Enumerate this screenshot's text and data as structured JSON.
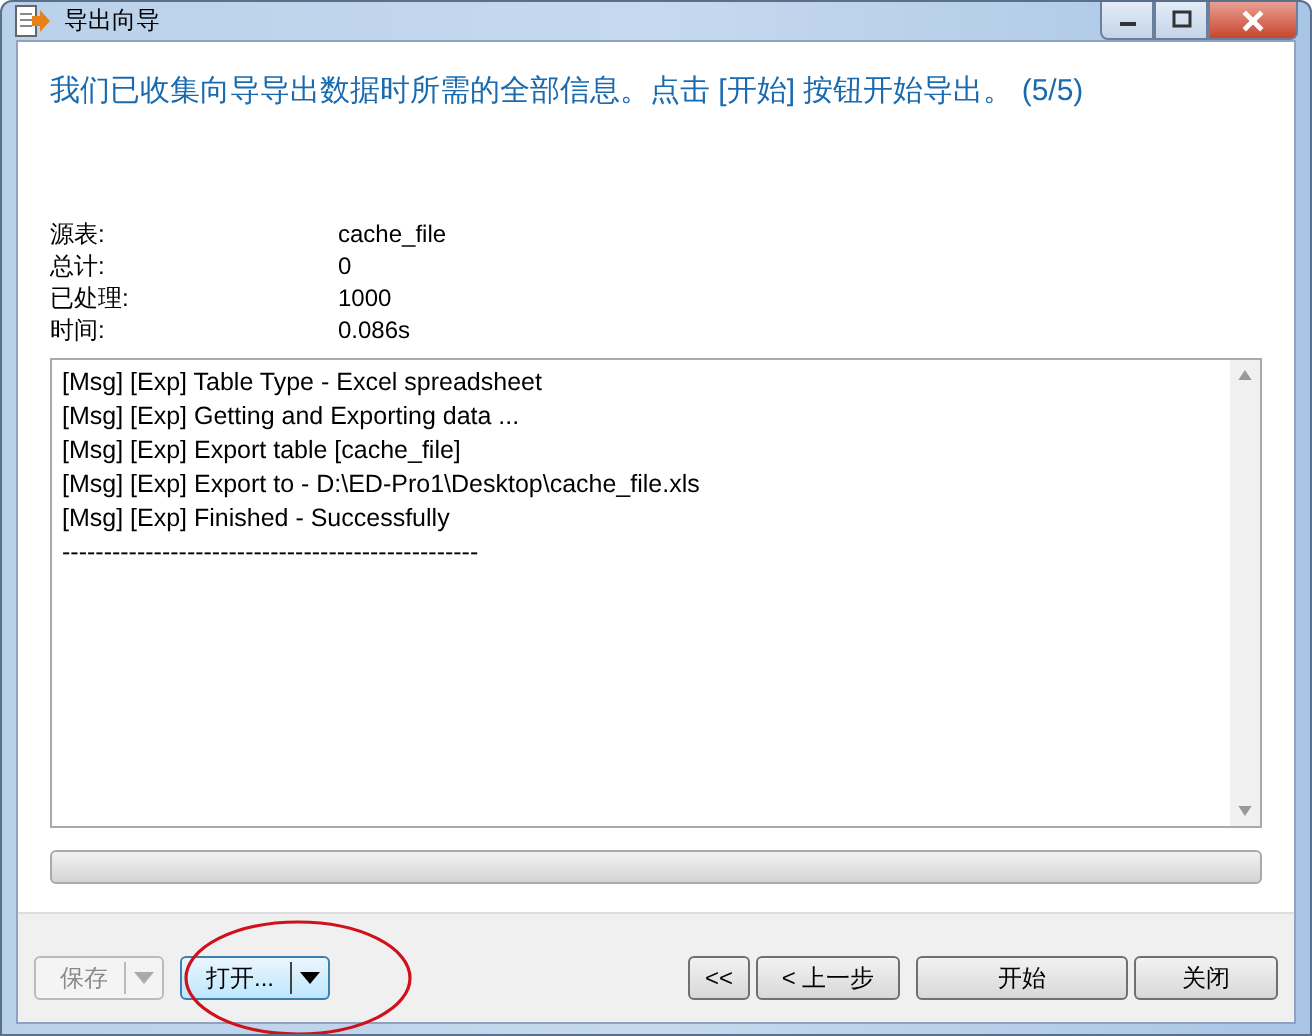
{
  "window": {
    "title": "导出向导"
  },
  "heading": "我们已收集向导导出数据时所需的全部信息。点击 [开始] 按钮开始导出。 (5/5)",
  "summary": [
    {
      "label": "源表:",
      "value": "cache_file"
    },
    {
      "label": "总计:",
      "value": "0"
    },
    {
      "label": "已处理:",
      "value": "1000"
    },
    {
      "label": "时间:",
      "value": "0.086s"
    }
  ],
  "log": [
    "[Msg] [Exp] Table Type - Excel spreadsheet",
    "[Msg] [Exp] Getting and Exporting data ...",
    "[Msg] [Exp] Export table [cache_file]",
    "[Msg] [Exp] Export to - D:\\ED-Pro1\\Desktop\\cache_file.xls",
    "[Msg] [Exp] Finished - Successfully",
    "--------------------------------------------------"
  ],
  "progress": {
    "level": 0
  },
  "left_buttons": [
    {
      "label": "保存",
      "disabled": true,
      "focused": false
    },
    {
      "label": "打开...",
      "disabled": false,
      "focused": true
    }
  ],
  "right_buttons": [
    {
      "label": "<<",
      "kind": "small"
    },
    {
      "label": "< 上一步",
      "kind": "normal"
    },
    {
      "label": "开始",
      "kind": "wide"
    },
    {
      "label": "关闭",
      "kind": "normal"
    }
  ],
  "annotation": {
    "kind": "ellipse"
  }
}
